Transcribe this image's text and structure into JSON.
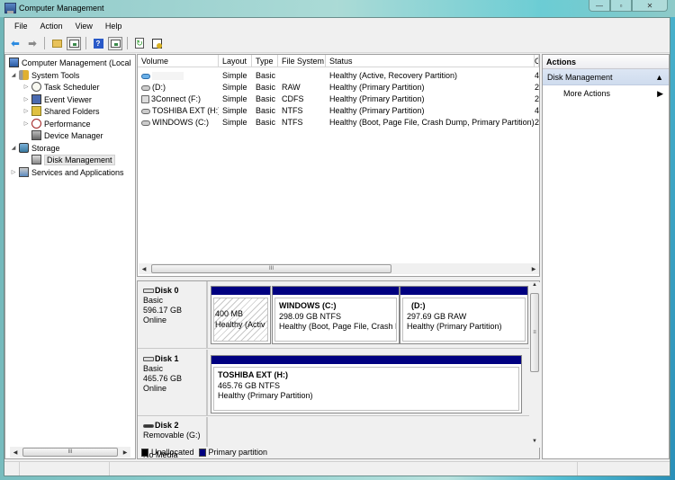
{
  "window": {
    "title": "Computer Management",
    "controls": {
      "minimize": "—",
      "maximize": "▫",
      "close": "✕"
    }
  },
  "menu": [
    "File",
    "Action",
    "View",
    "Help"
  ],
  "toolbar": {
    "buttons": [
      "back-icon",
      "forward-icon",
      "up-folder-icon",
      "show-hide-console-tree-icon",
      "help-icon",
      "show-hide-action-pane-icon",
      "refresh-icon",
      "properties-icon"
    ]
  },
  "tree": {
    "root": "Computer Management (Local",
    "items": [
      {
        "label": "System Tools",
        "expanded": true,
        "icon": "tools-icon"
      },
      {
        "label": "Task Scheduler",
        "icon": "clock-icon"
      },
      {
        "label": "Event Viewer",
        "icon": "event-viewer-icon"
      },
      {
        "label": "Shared Folders",
        "icon": "shared-folders-icon"
      },
      {
        "label": "Performance",
        "icon": "performance-icon"
      },
      {
        "label": "Device Manager",
        "icon": "device-manager-icon"
      },
      {
        "label": "Storage",
        "expanded": true,
        "icon": "storage-icon"
      },
      {
        "label": "Disk Management",
        "selected": true,
        "icon": "disk-icon"
      },
      {
        "label": "Services and Applications",
        "icon": "services-icon"
      }
    ]
  },
  "volumes": {
    "columns": [
      "Volume",
      "Layout",
      "Type",
      "File System",
      "Status",
      "C"
    ],
    "rows": [
      {
        "volume": "",
        "layout": "Simple",
        "type": "Basic",
        "fs": "",
        "status": "Healthy (Active, Recovery Partition)",
        "cap": "4"
      },
      {
        "volume": "(D:)",
        "layout": "Simple",
        "type": "Basic",
        "fs": "RAW",
        "status": "Healthy (Primary Partition)",
        "cap": "2"
      },
      {
        "volume": "3Connect (F:)",
        "layout": "Simple",
        "type": "Basic",
        "fs": "CDFS",
        "status": "Healthy (Primary Partition)",
        "cap": "2"
      },
      {
        "volume": "TOSHIBA EXT (H:)",
        "layout": "Simple",
        "type": "Basic",
        "fs": "NTFS",
        "status": "Healthy (Primary Partition)",
        "cap": "4"
      },
      {
        "volume": "WINDOWS (C:)",
        "layout": "Simple",
        "type": "Basic",
        "fs": "NTFS",
        "status": "Healthy (Boot, Page File, Crash Dump, Primary Partition)",
        "cap": "2"
      }
    ]
  },
  "disks": [
    {
      "name": "Disk 0",
      "kind": "Basic",
      "size": "596.17 GB",
      "state": "Online",
      "partitions": [
        {
          "name": "",
          "size": "400 MB",
          "status": "Healthy (Activ"
        },
        {
          "name": "WINDOWS  (C:)",
          "size": "298.09 GB NTFS",
          "status": "Healthy (Boot, Page File, Crash D"
        },
        {
          "name": "(D:)",
          "size": "297.69 GB RAW",
          "status": "Healthy (Primary Partition)"
        }
      ]
    },
    {
      "name": "Disk 1",
      "kind": "Basic",
      "size": "465.76 GB",
      "state": "Online",
      "partitions": [
        {
          "name": "TOSHIBA EXT  (H:)",
          "size": "465.76 GB NTFS",
          "status": "Healthy (Primary Partition)"
        }
      ]
    },
    {
      "name": "Disk 2",
      "kind": "Removable (G:)",
      "size": "",
      "state": "No Media",
      "partitions": []
    }
  ],
  "legend": [
    {
      "label": "Unallocated",
      "color": "#000000"
    },
    {
      "label": "Primary partition",
      "color": "#000080"
    }
  ],
  "actions": {
    "header": "Actions",
    "section": "Disk Management",
    "items": [
      "More Actions"
    ]
  },
  "scroll_glyph": "III",
  "colors": {
    "primary_partition": "#000080",
    "actions_section": "#d6e1f1"
  }
}
